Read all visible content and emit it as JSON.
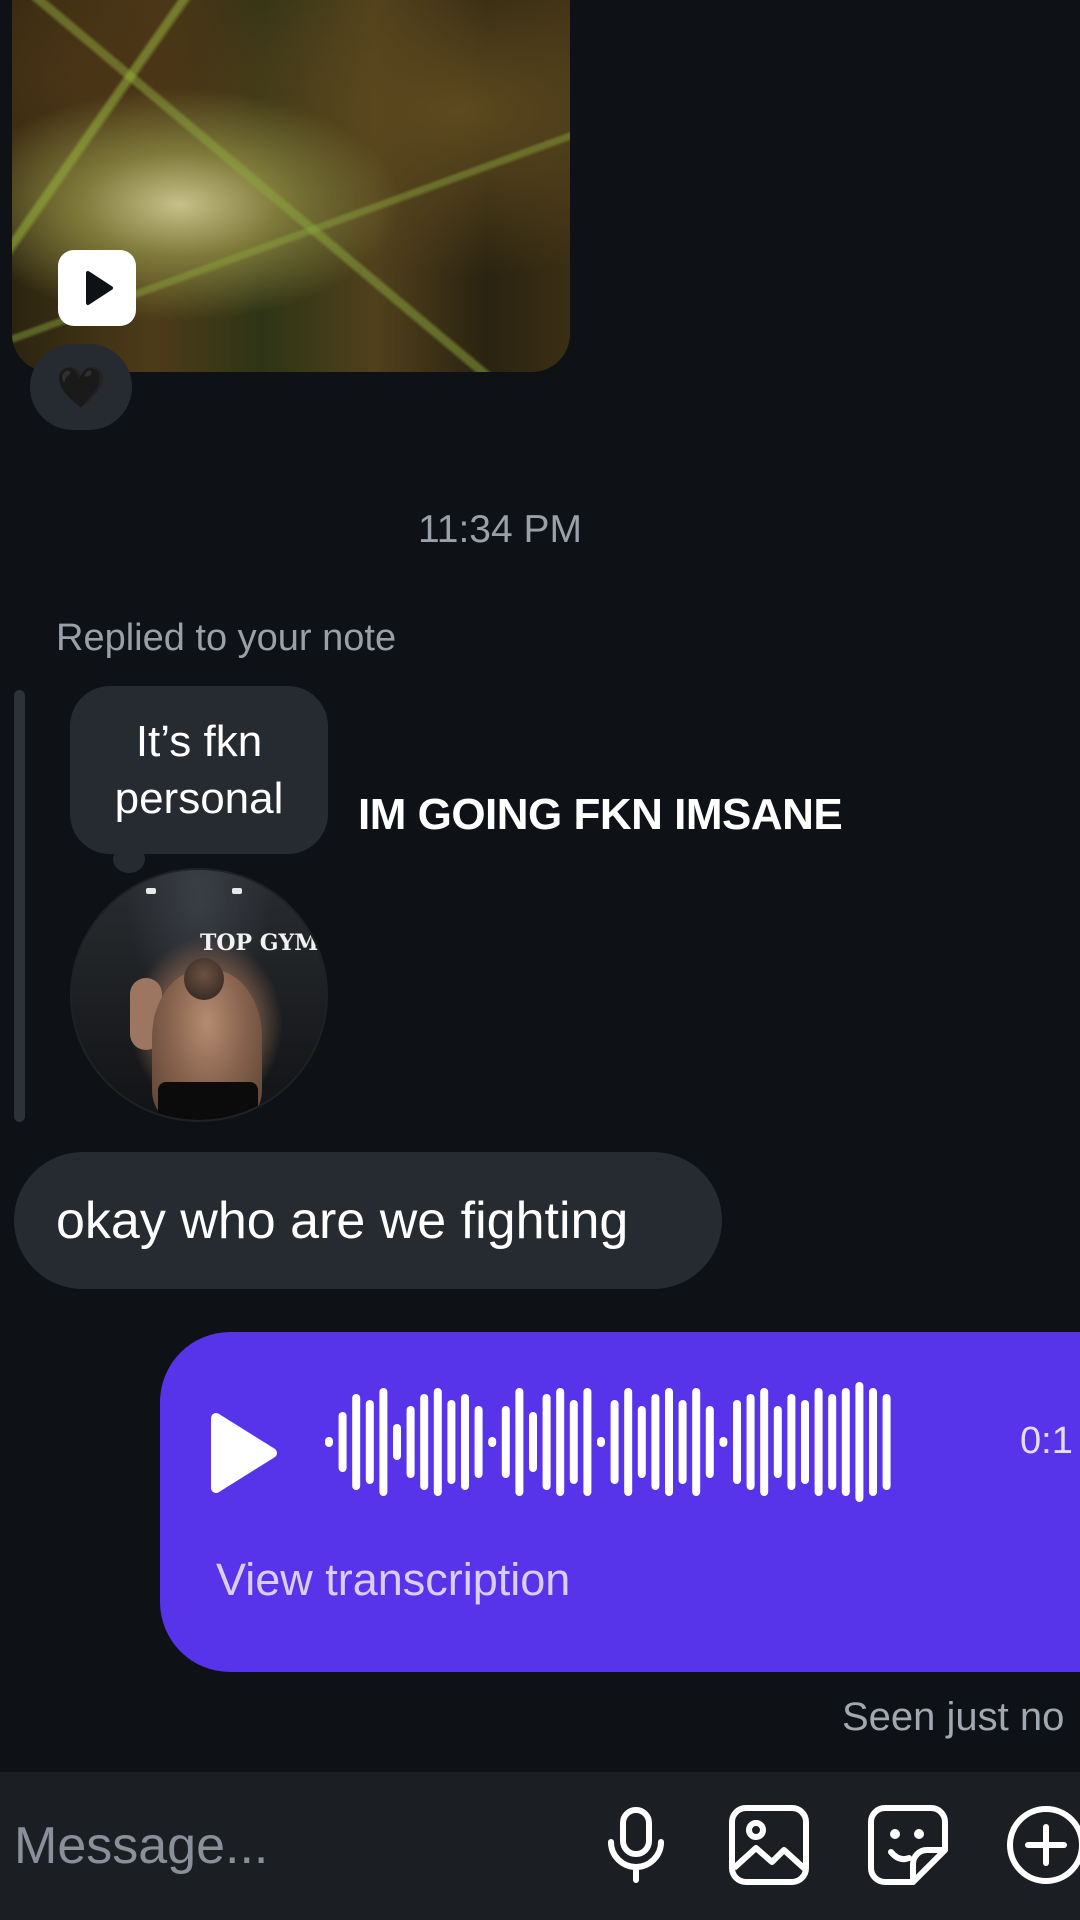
{
  "thread": {
    "video_message": {
      "play_icon": "play-icon",
      "reaction_emoji": "🖤"
    },
    "timestamp": "11:34 PM",
    "note_reply": {
      "label": "Replied to your note",
      "note_text": "It’s fkn personal",
      "avatar_sign": "TOP GYM"
    },
    "caption_overlay": "IM GOING FKN IMSANE",
    "incoming_text": "okay who are we fighting",
    "voice_message": {
      "duration": "0:1",
      "view_transcription": "View transcription",
      "accent_color": "#5733ea"
    },
    "seen_status": "Seen just no"
  },
  "composer": {
    "placeholder": "Message...",
    "icons": [
      "microphone-icon",
      "gallery-icon",
      "sticker-icon",
      "add-icon"
    ]
  }
}
